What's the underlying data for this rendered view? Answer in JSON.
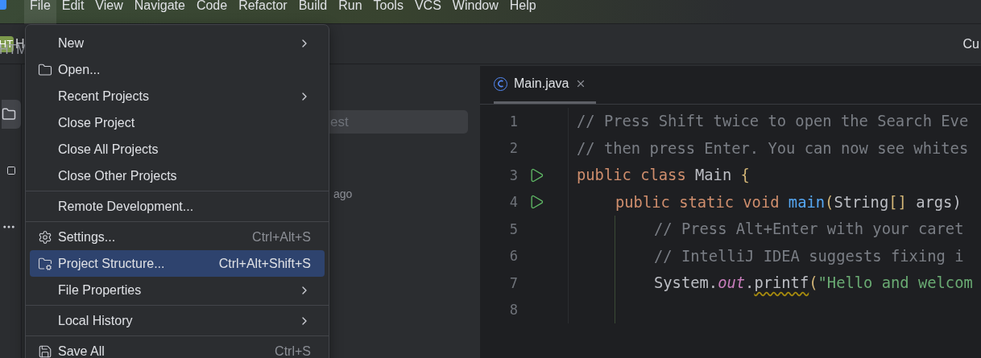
{
  "menu_bar": {
    "items": [
      {
        "label": "File",
        "selected": true
      },
      {
        "label": "Edit",
        "selected": false
      },
      {
        "label": "View",
        "selected": false
      },
      {
        "label": "Navigate",
        "selected": false
      },
      {
        "label": "Code",
        "selected": false
      },
      {
        "label": "Refactor",
        "selected": false
      },
      {
        "label": "Build",
        "selected": false
      },
      {
        "label": "Run",
        "selected": false
      },
      {
        "label": "Tools",
        "selected": false
      },
      {
        "label": "VCS",
        "selected": false
      },
      {
        "label": "Window",
        "selected": false
      },
      {
        "label": "Help",
        "selected": false
      }
    ]
  },
  "toolbar": {
    "project_badge": "HT",
    "project_name": "H",
    "right_text": "Cu"
  },
  "project_panel": {
    "title": "HTM",
    "search": {
      "value": "est"
    },
    "time_text": "ago"
  },
  "file_menu": [
    {
      "kind": "plain",
      "label": "New",
      "submenu": true,
      "selected": false
    },
    {
      "kind": "folder",
      "label": "Open...",
      "submenu": false,
      "selected": false
    },
    {
      "kind": "plain",
      "label": "Recent Projects",
      "submenu": true,
      "selected": false
    },
    {
      "kind": "plain",
      "label": "Close Project",
      "submenu": false,
      "selected": false
    },
    {
      "kind": "plain",
      "label": "Close All Projects",
      "submenu": false,
      "selected": false
    },
    {
      "kind": "plain",
      "label": "Close Other Projects",
      "submenu": false,
      "selected": false
    },
    {
      "kind": "separator"
    },
    {
      "kind": "plain",
      "label": "Remote Development...",
      "submenu": false,
      "selected": false
    },
    {
      "kind": "separator"
    },
    {
      "kind": "gear",
      "label": "Settings...",
      "shortcut": "Ctrl+Alt+S",
      "submenu": false,
      "selected": false
    },
    {
      "kind": "structure",
      "label": "Project Structure...",
      "shortcut": "Ctrl+Alt+Shift+S",
      "submenu": false,
      "selected": true
    },
    {
      "kind": "plain",
      "label": "File Properties",
      "submenu": true,
      "selected": false
    },
    {
      "kind": "separator"
    },
    {
      "kind": "plain",
      "label": "Local History",
      "submenu": true,
      "selected": false
    },
    {
      "kind": "separator"
    },
    {
      "kind": "save",
      "label": "Save All",
      "shortcut": "Ctrl+S",
      "submenu": false,
      "selected": false
    }
  ],
  "editor": {
    "tabs": [
      {
        "label": "Main.java",
        "selected": true
      }
    ],
    "lines": [
      {
        "number": "1",
        "kind": "top",
        "run": false,
        "tokens": [
          {
            "text": "// Press Shift twice to open the Search Eve",
            "kind": "comment"
          }
        ]
      },
      {
        "number": "2",
        "kind": "top",
        "run": false,
        "tokens": [
          {
            "text": "// then press Enter. You can now see whites",
            "kind": "comment"
          }
        ]
      },
      {
        "number": "3",
        "kind": "top",
        "run": true,
        "tokens": [
          {
            "text": "public class",
            "kind": "keyword"
          },
          {
            "text": " Main ",
            "kind": "plain"
          },
          {
            "text": "{",
            "kind": "brace"
          }
        ]
      },
      {
        "number": "4",
        "kind": "member",
        "run": true,
        "tokens": [
          {
            "text": "public static void ",
            "kind": "keyword"
          },
          {
            "text": "main",
            "kind": "method"
          },
          {
            "text": "(",
            "kind": "brace"
          },
          {
            "text": "String",
            "kind": "plain"
          },
          {
            "text": "[]",
            "kind": "brace"
          },
          {
            "text": " args)",
            "kind": "plain"
          }
        ]
      },
      {
        "number": "5",
        "kind": "body",
        "run": false,
        "tokens": [
          {
            "text": "// Press Alt+Enter with your caret",
            "kind": "comment"
          }
        ]
      },
      {
        "number": "6",
        "kind": "body",
        "run": false,
        "tokens": [
          {
            "text": "// IntelliJ IDEA suggests fixing i",
            "kind": "comment"
          }
        ]
      },
      {
        "number": "7",
        "kind": "body",
        "run": false,
        "tokens": [
          {
            "text": "System.",
            "kind": "plain"
          },
          {
            "text": "out",
            "kind": "static"
          },
          {
            "text": ".",
            "kind": "plain"
          },
          {
            "text": "printf",
            "kind": "warning"
          },
          {
            "text": "(",
            "kind": "brace"
          },
          {
            "text": "\"Hello and welcom",
            "kind": "string"
          }
        ]
      },
      {
        "number": "8",
        "kind": "body",
        "run": false
      }
    ]
  }
}
